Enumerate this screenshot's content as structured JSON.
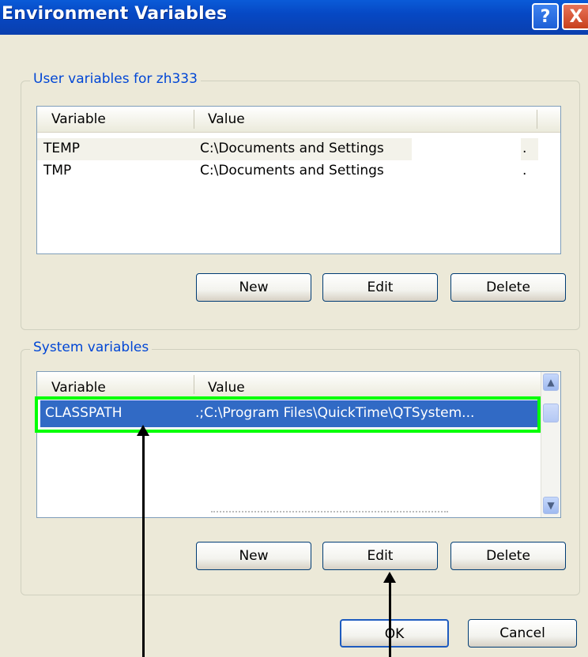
{
  "window": {
    "title": "Environment Variables",
    "help_glyph": "?",
    "close_glyph": "X"
  },
  "user_vars": {
    "group_label": "User variables for zh333",
    "columns": [
      "Variable",
      "Value"
    ],
    "rows": [
      {
        "variable": "TEMP",
        "value": "C:\\Documents and Settings"
      },
      {
        "variable": "TMP",
        "value": "C:\\Documents and Settings"
      }
    ],
    "buttons": {
      "new": "New",
      "edit": "Edit",
      "delete": "Delete"
    }
  },
  "system_vars": {
    "group_label": "System variables",
    "columns": [
      "Variable",
      "Value"
    ],
    "rows": [
      {
        "variable": "CLASSPATH",
        "value": ".;C:\\Program Files\\QuickTime\\QTSystem...",
        "selected": true
      }
    ],
    "buttons": {
      "new": "New",
      "edit": "Edit",
      "delete": "Delete"
    }
  },
  "footer": {
    "ok": "OK",
    "cancel": "Cancel"
  },
  "colors": {
    "title_bar": "#0a5bd8",
    "selection": "#316ac5",
    "highlight_box": "#00ff00",
    "group_label": "#0046d5"
  }
}
